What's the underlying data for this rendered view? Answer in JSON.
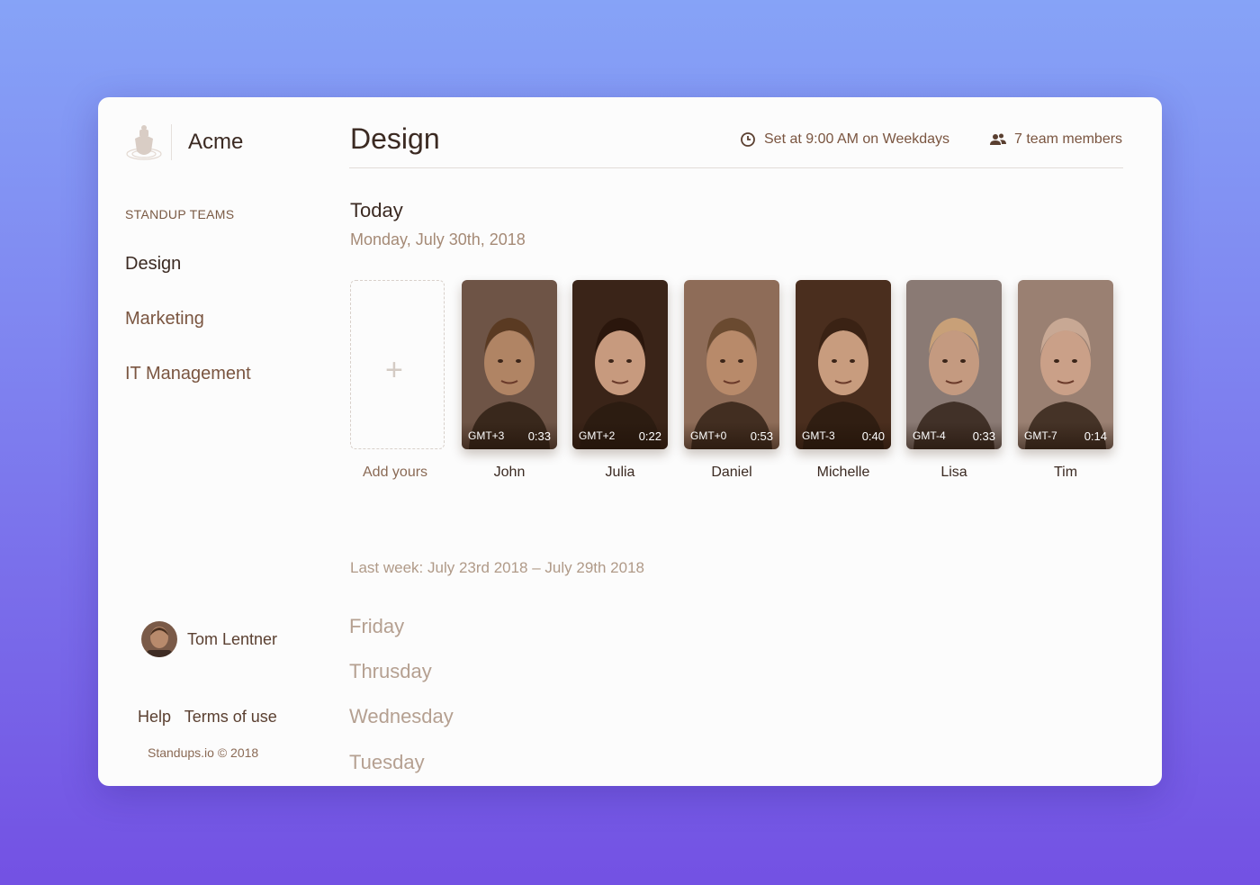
{
  "sidebar": {
    "brand": "Acme",
    "section_title": "STANDUP TEAMS",
    "teams": [
      {
        "label": "Design",
        "active": true
      },
      {
        "label": "Marketing",
        "active": false
      },
      {
        "label": "IT Management",
        "active": false
      }
    ],
    "user": {
      "name": "Tom Lentner"
    },
    "links": {
      "help": "Help",
      "terms": "Terms of use"
    },
    "copyright": "Standups.io © 2018"
  },
  "header": {
    "title": "Design",
    "schedule": "Set at 9:00 AM on Weekdays",
    "members": "7 team members"
  },
  "today": {
    "heading": "Today",
    "date": "Monday, July 30th, 2018",
    "add_label": "Add yours",
    "videos": [
      {
        "name": "John",
        "tz": "GMT+3",
        "duration": "0:33",
        "bg": "#6e5446",
        "skin": "#b08464",
        "hair": "#5a3a22"
      },
      {
        "name": "Julia",
        "tz": "GMT+2",
        "duration": "0:22",
        "bg": "#3a2418",
        "skin": "#c79a7e",
        "hair": "#2a160c"
      },
      {
        "name": "Daniel",
        "tz": "GMT+0",
        "duration": "0:53",
        "bg": "#8e6c58",
        "skin": "#b88a6a",
        "hair": "#6a4a30"
      },
      {
        "name": "Michelle",
        "tz": "GMT-3",
        "duration": "0:40",
        "bg": "#4a2e1e",
        "skin": "#c89c7e",
        "hair": "#3a2214"
      },
      {
        "name": "Lisa",
        "tz": "GMT-4",
        "duration": "0:33",
        "bg": "#8a7a74",
        "skin": "#c49a80",
        "hair": "#c8a078"
      },
      {
        "name": "Tim",
        "tz": "GMT-7",
        "duration": "0:14",
        "bg": "#9a8072",
        "skin": "#caa088",
        "hair": "#c8a894"
      }
    ]
  },
  "last_week": {
    "label": "Last week: July 23rd 2018 – July 29th 2018",
    "days": [
      "Friday",
      "Thrusday",
      "Wednesday",
      "Tuesday"
    ]
  }
}
